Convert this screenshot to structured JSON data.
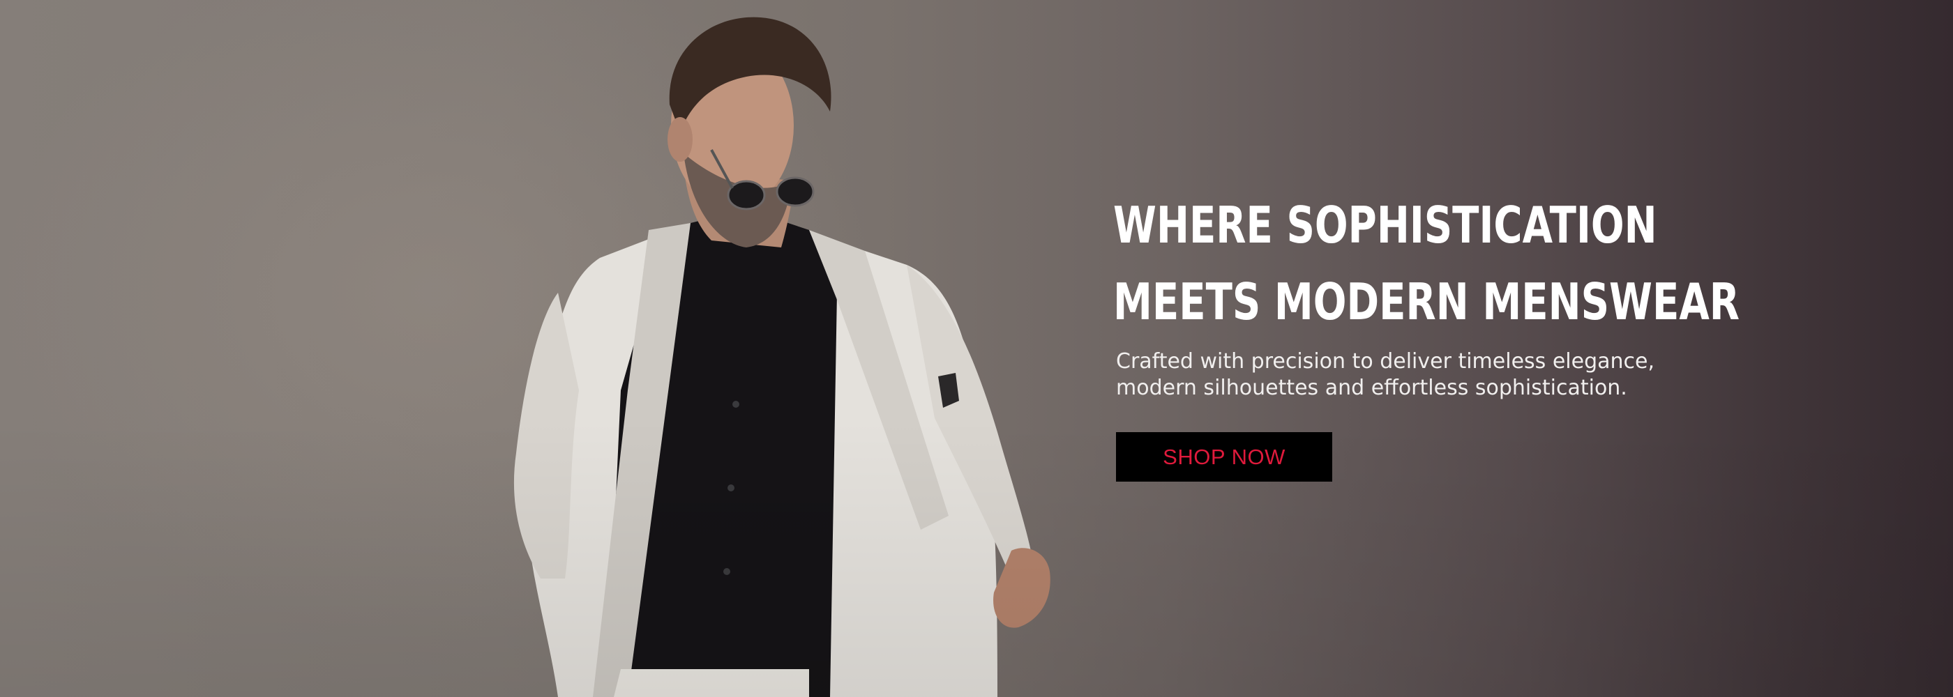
{
  "hero": {
    "headline": {
      "line1": "WHERE SOPHISTICATION",
      "line2": "MEETS MODERN MENSWEAR"
    },
    "subtext": {
      "line1": "Crafted with precision to deliver timeless elegance,",
      "line2": "modern silhouettes and effortless sophistication."
    },
    "cta_label": "SHOP NOW",
    "colors": {
      "cta_background": "#000000",
      "cta_text": "#e11a3c",
      "headline": "#ffffff"
    }
  }
}
